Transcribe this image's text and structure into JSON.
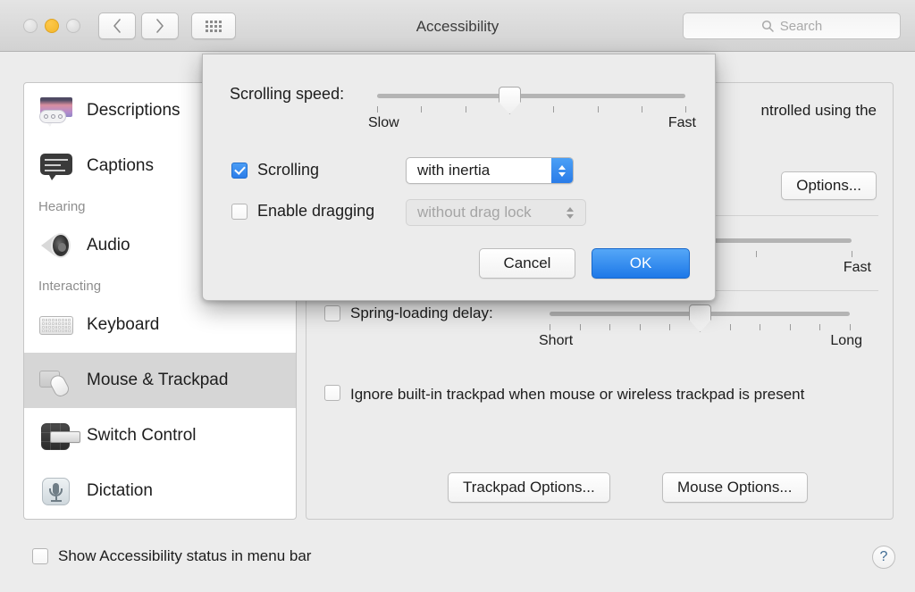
{
  "window": {
    "title": "Accessibility",
    "traffic_lights": [
      "close",
      "minimize",
      "zoom"
    ],
    "nav": {
      "back": "back-arrow",
      "forward": "forward-arrow",
      "grid": "show-all-grid"
    },
    "search": {
      "placeholder": "Search",
      "value": "",
      "icon": "search-icon"
    }
  },
  "sidebar": {
    "items": [
      {
        "label": "Descriptions",
        "icon": "descriptions-icon",
        "type": "item",
        "selected": false
      },
      {
        "label": "Captions",
        "icon": "captions-icon",
        "type": "item",
        "selected": false
      },
      {
        "label": "Hearing",
        "type": "header"
      },
      {
        "label": "Audio",
        "icon": "audio-icon",
        "type": "item",
        "selected": false
      },
      {
        "label": "Interacting",
        "type": "header"
      },
      {
        "label": "Keyboard",
        "icon": "keyboard-icon",
        "type": "item",
        "selected": false
      },
      {
        "label": "Mouse & Trackpad",
        "icon": "mouse-trackpad-icon",
        "type": "item",
        "selected": true
      },
      {
        "label": "Switch Control",
        "icon": "switch-control-icon",
        "type": "item",
        "selected": false
      },
      {
        "label": "Dictation",
        "icon": "dictation-icon",
        "type": "item",
        "selected": false
      }
    ]
  },
  "panel": {
    "description": "ntrolled using the",
    "options_button": "Options...",
    "double_click_slider": {
      "max_label": "Fast",
      "ticks": 5,
      "value_pct": 50
    },
    "spring_loading": {
      "label": "Spring-loading delay:",
      "checked": false,
      "min_label": "Short",
      "max_label": "Long",
      "ticks": 11,
      "value_pct": 50
    },
    "ignore_trackpad": {
      "label": "Ignore built-in trackpad when mouse or wireless trackpad is present",
      "checked": false
    },
    "trackpad_options_button": "Trackpad Options...",
    "mouse_options_button": "Mouse Options..."
  },
  "dialog": {
    "scrolling_speed": {
      "label": "Scrolling speed:",
      "min_label": "Slow",
      "max_label": "Fast",
      "ticks": 8,
      "value_pct": 43
    },
    "scrolling": {
      "label": "Scrolling",
      "checked": true,
      "popup_value": "with inertia",
      "enabled": true
    },
    "enable_dragging": {
      "label": "Enable dragging",
      "checked": false,
      "popup_value": "without drag lock",
      "enabled": false
    },
    "cancel_button": "Cancel",
    "ok_button": "OK"
  },
  "footer": {
    "show_status": {
      "label": "Show Accessibility status in menu bar",
      "checked": false
    },
    "help_button": "?"
  },
  "colors": {
    "accent_blue": "#2b7de9",
    "window_bg": "#ececec",
    "sidebar_bg": "#ffffff",
    "selection_gray": "#d6d6d6"
  }
}
